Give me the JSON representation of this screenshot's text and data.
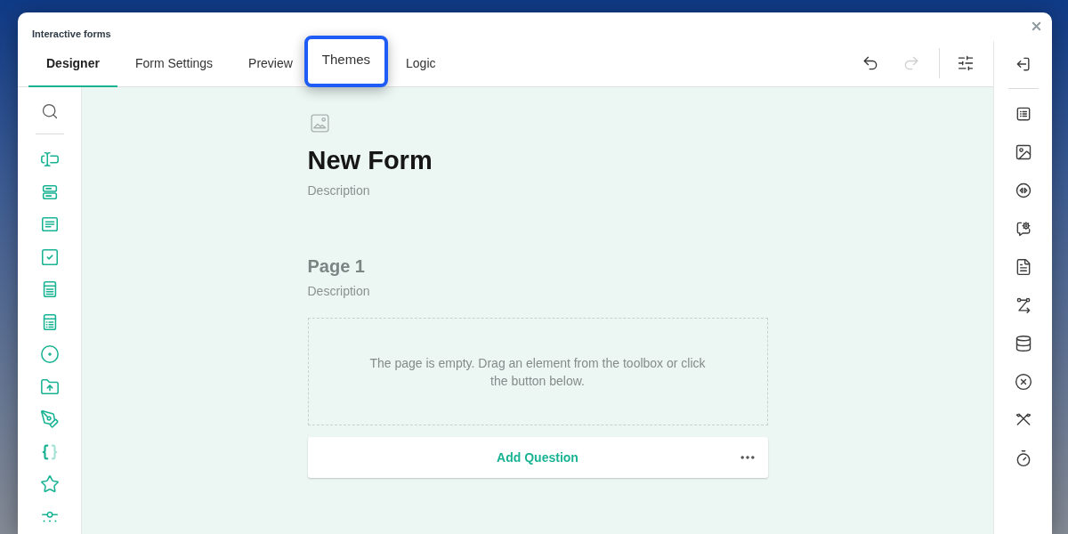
{
  "dialog": {
    "title": "Interactive forms"
  },
  "tabs": [
    {
      "label": "Designer",
      "selected": true,
      "highlighted": false
    },
    {
      "label": "Form Settings",
      "selected": false,
      "highlighted": false
    },
    {
      "label": "Preview",
      "selected": false,
      "highlighted": false
    },
    {
      "label": "Themes",
      "selected": false,
      "highlighted": true
    },
    {
      "label": "Logic",
      "selected": false,
      "highlighted": false
    }
  ],
  "toolbar": [
    {
      "kind": "undo",
      "disabled": false
    },
    {
      "kind": "redo",
      "disabled": true
    },
    {
      "kind": "settings",
      "disabled": false
    }
  ],
  "form": {
    "title": "New Form",
    "description": "Description"
  },
  "page": {
    "title": "Page 1",
    "description": "Description",
    "empty_message": "The page is empty. Drag an element from the toolbox or click the button below."
  },
  "add_question": {
    "label": "Add Question"
  }
}
